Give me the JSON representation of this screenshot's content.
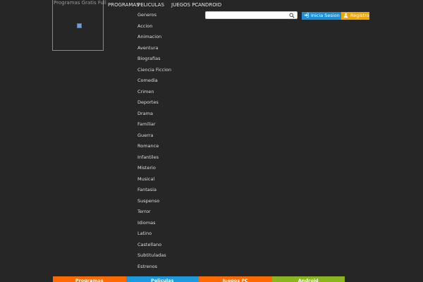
{
  "logo": {
    "text": "Programas Gratis Full"
  },
  "nav": {
    "items": [
      "PROGRAMAS",
      "PELICULAS",
      "JUEGOS PC",
      "ANDROID"
    ]
  },
  "genres": {
    "header": "Generos",
    "items": [
      "Accion",
      "Animacion",
      "Aventura",
      "Biografias",
      "Ciencia Ficcion",
      "Comedia",
      "Crimen",
      "Deportes",
      "Drama",
      "Familiar",
      "Guerra",
      "Romance",
      "Infantiles",
      "Misterio",
      "Musical",
      "Fantasia",
      "Suspenso",
      "Terror",
      "Idiomas",
      "Latino",
      "Castellano",
      "Subtituladas",
      "Estrenos"
    ]
  },
  "search": {
    "value": "",
    "placeholder": "",
    "icon": "search-icon"
  },
  "auth": {
    "login_label": "Inicia Sesion",
    "register_label": "Registro",
    "login_color": "#1a8fd8",
    "register_color": "#f0a500"
  },
  "footer": {
    "tabs": [
      {
        "label": "Programas",
        "color": "#ff6a00"
      },
      {
        "label": "Peliculas",
        "color": "#1a9be0"
      },
      {
        "label": "Juegos PC",
        "color": "#ff6a00"
      },
      {
        "label": "Android",
        "color": "#8ab51c"
      }
    ]
  },
  "colors": {
    "background": "#262626",
    "text": "#dcdcdc"
  }
}
